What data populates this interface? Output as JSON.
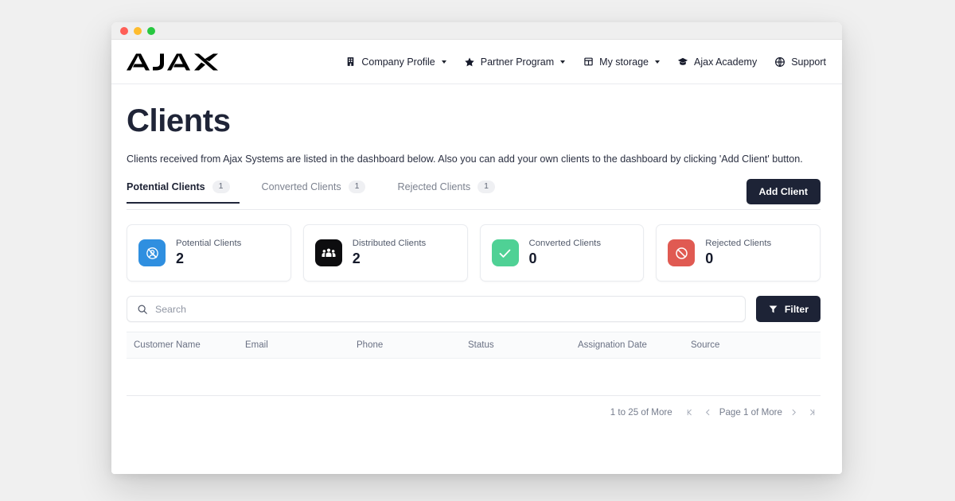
{
  "window": {
    "traffic_lights": [
      "close",
      "minimize",
      "maximize"
    ]
  },
  "header": {
    "logo_text": "AJAX",
    "nav": [
      {
        "label": "Company Profile",
        "icon": "building-icon",
        "caret": true
      },
      {
        "label": "Partner Program",
        "icon": "star-icon",
        "caret": true
      },
      {
        "label": "My storage",
        "icon": "box-icon",
        "caret": true
      },
      {
        "label": "Ajax Academy",
        "icon": "graduation-cap-icon",
        "caret": false
      },
      {
        "label": "Support",
        "icon": "globe-help-icon",
        "caret": false
      }
    ]
  },
  "main": {
    "title": "Clients",
    "description": "Clients received from Ajax Systems are listed in the dashboard below. Also you can add your own clients to the dashboard by clicking 'Add Client' button.",
    "tabs": [
      {
        "label": "Potential Clients",
        "count": "1",
        "active": true
      },
      {
        "label": "Converted Clients",
        "count": "1",
        "active": false
      },
      {
        "label": "Rejected Clients",
        "count": "1",
        "active": false
      }
    ],
    "add_client_label": "Add Client",
    "cards": [
      {
        "label": "Potential Clients",
        "value": "2",
        "icon": "target-user-icon",
        "color": "#2f8fe0"
      },
      {
        "label": "Distributed Clients",
        "value": "2",
        "icon": "people-group-icon",
        "color": "#0d0d0f"
      },
      {
        "label": "Converted Clients",
        "value": "0",
        "icon": "check-icon",
        "color": "#4fd195"
      },
      {
        "label": "Rejected Clients",
        "value": "0",
        "icon": "block-icon",
        "color": "#e05a52"
      }
    ],
    "search": {
      "placeholder": "Search",
      "value": "",
      "icon": "search-icon"
    },
    "filter_label": "Filter",
    "filter_icon": "funnel-icon",
    "table": {
      "columns": [
        "Customer Name",
        "Email",
        "Phone",
        "Status",
        "Assignation Date",
        "Source"
      ],
      "rows": []
    },
    "pagination": {
      "range_text": "1 to 25 of More",
      "page_text": "Page 1 of More",
      "first_icon": "first-page-icon",
      "prev_icon": "prev-page-icon",
      "next_icon": "next-page-icon",
      "last_icon": "last-page-icon"
    }
  },
  "colors": {
    "accent_dark": "#1d2336",
    "blue": "#2f8fe0",
    "green": "#4fd195",
    "red": "#e05a52",
    "black": "#0d0d0f"
  }
}
